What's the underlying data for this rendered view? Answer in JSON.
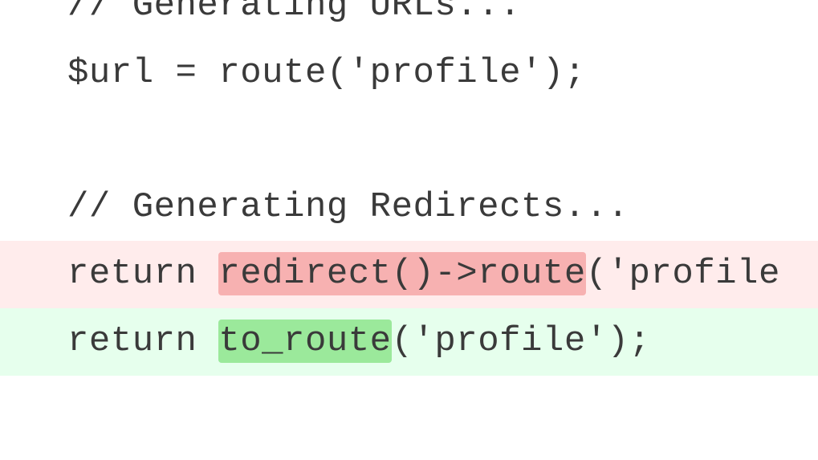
{
  "code": {
    "line1": "// Generating URLs...",
    "line2a": "$url = route(",
    "line2b": "'profile'",
    "line2c": ");",
    "line3": "",
    "line4": "// Generating Redirects...",
    "line5a": "return ",
    "line5b": "redirect()->route",
    "line5c": "(",
    "line5d": "'profile",
    "line6a": "return ",
    "line6b": "to_route",
    "line6c": "(",
    "line6d": "'profile'",
    "line6e": ");"
  }
}
